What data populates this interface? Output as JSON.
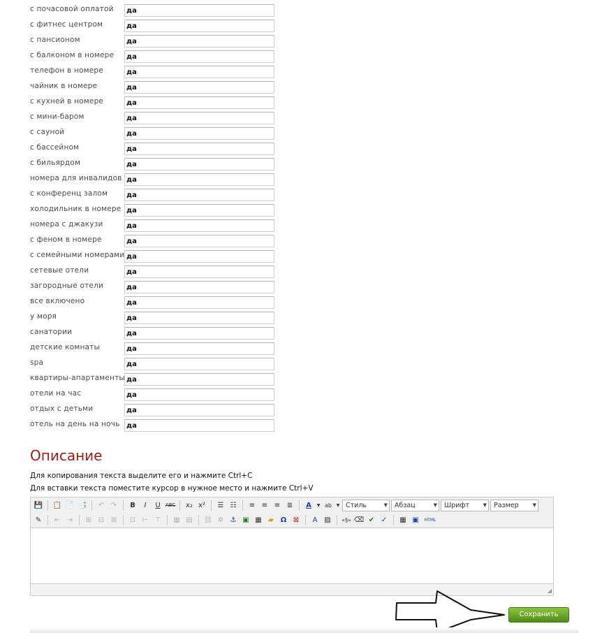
{
  "amenities": [
    {
      "label": "с почасовой оплатой",
      "value": "да"
    },
    {
      "label": "с фитнес центром",
      "value": "да"
    },
    {
      "label": "с пансионом",
      "value": "да"
    },
    {
      "label": "с балконом в номере",
      "value": "да"
    },
    {
      "label": "телефон в номере",
      "value": "да"
    },
    {
      "label": "чайник в номере",
      "value": "да"
    },
    {
      "label": "с кухней в номере",
      "value": "да"
    },
    {
      "label": "с мини-баром",
      "value": "да"
    },
    {
      "label": "с сауной",
      "value": "да"
    },
    {
      "label": "с бассейном",
      "value": "да"
    },
    {
      "label": "с бильярдом",
      "value": "да"
    },
    {
      "label": "номера для инвалидов",
      "value": "да"
    },
    {
      "label": "с конференц залом",
      "value": "да"
    },
    {
      "label": "холодильник в номере",
      "value": "да"
    },
    {
      "label": "номера с джакузи",
      "value": "да"
    },
    {
      "label": "с феном в номере",
      "value": "да"
    },
    {
      "label": "с семейными номерами",
      "value": "да"
    },
    {
      "label": "сетевые отели",
      "value": "да"
    },
    {
      "label": "загородные отели",
      "value": "да"
    },
    {
      "label": "все включено",
      "value": "да"
    },
    {
      "label": "у моря",
      "value": "да"
    },
    {
      "label": "санатории",
      "value": "да"
    },
    {
      "label": "детские комнаты",
      "value": "да"
    },
    {
      "label": "spa",
      "value": "да"
    },
    {
      "label": "квартиры-апартаменты",
      "value": "да"
    },
    {
      "label": "отели на час",
      "value": "да"
    },
    {
      "label": "отдых с детьми",
      "value": "да"
    },
    {
      "label": "отель на день на ночь",
      "value": "да"
    }
  ],
  "description": {
    "title": "Описание",
    "hint_copy": "Для копирования текста выделите его и нажмите Ctrl+C",
    "hint_paste": "Для вставки текста поместите курсор в нужное место и нажмите Ctrl+V"
  },
  "editor": {
    "style_combo": "Стиль",
    "format_combo": "Абзац",
    "font_combo": "Шрифт",
    "size_combo": "Размер",
    "html_button": "HTML"
  },
  "save_label": "Сохранить",
  "colors": {
    "title": "#9b1b12",
    "save_button": "#5e9e1e"
  }
}
